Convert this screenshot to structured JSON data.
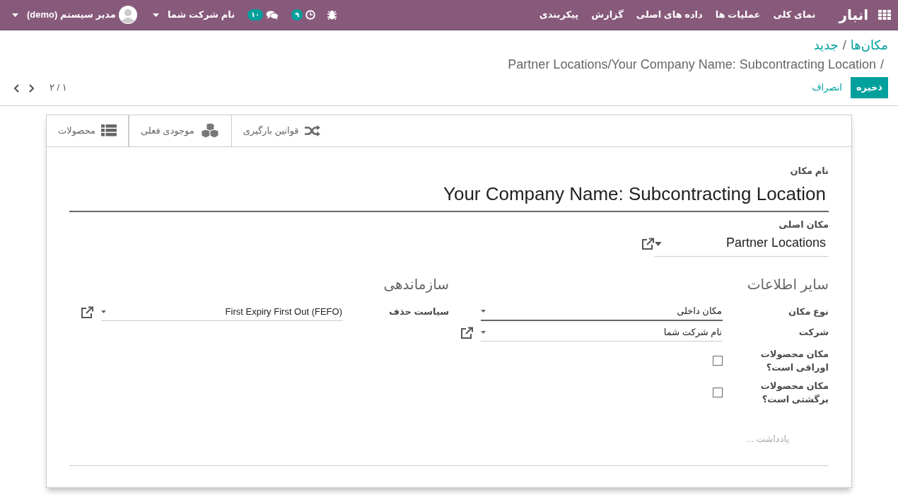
{
  "navbar": {
    "brand": "انبار",
    "menu": [
      "نمای کلی",
      "عملیات ها",
      "داده های اصلی",
      "گزارش",
      "پیکربندی"
    ],
    "activity_badge": "۹",
    "messages_badge": "۱۰",
    "company": "نام شرکت شما",
    "user": "مدیر سیستم (demo)"
  },
  "breadcrumbs": [
    {
      "label": "مکان‌ها",
      "active": false
    },
    {
      "label": "جدید",
      "active": false
    },
    {
      "label": "Partner Locations/Your Company Name: Subcontracting Location",
      "active": true
    }
  ],
  "separator": "/",
  "actions": {
    "save": "ذخیره",
    "discard": "انصراف"
  },
  "pager": "۱ / ۲",
  "stat_buttons": [
    {
      "label": "قوانین بارگیری",
      "kind": "routes"
    },
    {
      "label": "موجودی فعلی",
      "kind": "stock"
    },
    {
      "label": "محصولات",
      "kind": "products"
    }
  ],
  "form": {
    "name_label": "نام مکان",
    "name": "Your Company Name: Subcontracting Location",
    "parent_label": "مکان اصلی",
    "parent": "Partner Locations",
    "groups": [
      {
        "title": "سایر اطلاعات",
        "fields": [
          {
            "kind": "select",
            "label": "نوع مکان",
            "value": "مکان داخلی",
            "focused": true,
            "external_link": false
          },
          {
            "kind": "select",
            "label": "شرکت",
            "value": "نام شرکت شما",
            "focused": false,
            "external_link": true
          },
          {
            "kind": "checkbox",
            "label": "مکان محصولات اوراقی است؟",
            "checked": false
          },
          {
            "kind": "checkbox",
            "label": "مکان محصولات برگشتی است؟",
            "checked": false
          }
        ]
      },
      {
        "title": "سازماندهی",
        "fields": [
          {
            "kind": "select",
            "label": "سیاست حذف",
            "value": "First Expiry First Out (FEFO)",
            "focused": false,
            "external_link": true
          }
        ]
      }
    ],
    "notes_placeholder": "یادداشت ..."
  }
}
